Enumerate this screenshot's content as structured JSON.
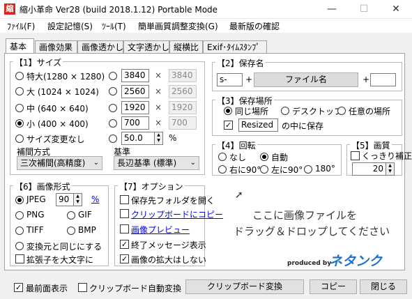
{
  "window": {
    "title": "縮小革命 Ver28  (build 2018.1.12)   Portable Mode",
    "icon_char": "縮",
    "minimize": "—",
    "maximize": "☐",
    "close": "✕"
  },
  "menu": [
    "ﾌｧｲﾙ(F)",
    "設定記憶(S)",
    "ﾂｰﾙ(T)",
    "簡単画質調整変換(G)",
    "最新版の確認"
  ],
  "tabs": [
    "基本",
    "画像効果",
    "画像透かし",
    "文字透かし",
    "縦横比",
    "Exif･ﾀｲﾑｽﾀﾝﾌﾟ"
  ],
  "size": {
    "title": "【1】サイズ",
    "presets": [
      {
        "label": "特大(1280 × 1280)",
        "selected": false
      },
      {
        "label": "大 (1024 × 1024)",
        "selected": false
      },
      {
        "label": "中  (640 × 640)",
        "selected": false
      },
      {
        "label": "小  (400 × 400)",
        "selected": true
      },
      {
        "label": "サイズ変更なし",
        "selected": false
      }
    ],
    "custom": [
      {
        "value": "3840",
        "value2": "3840"
      },
      {
        "value": "2560",
        "value2": "2560"
      },
      {
        "value": "1920",
        "value2": "1920"
      },
      {
        "value": "700",
        "value2": "700"
      }
    ],
    "cross": "×",
    "percent_value": "50.0",
    "percent_unit": "%",
    "interp_label": "補間方式",
    "interp_value": "三次補間(高精度)",
    "basis_label": "基準",
    "basis_value": "長辺基準 (標準)"
  },
  "savename": {
    "title": "【2】保存名",
    "prefix": "s-",
    "plus": "+",
    "filename_button": "ファイル名",
    "suffix": ""
  },
  "saveplace": {
    "title": "【3】保存場所",
    "options": [
      {
        "label": "同じ場所",
        "selected": true
      },
      {
        "label": "デスクトップ",
        "selected": false
      },
      {
        "label": "任意の場所",
        "selected": false
      }
    ],
    "resized_checked": true,
    "resized_value": "Resized",
    "resized_suffix": "の中に保存"
  },
  "rotate": {
    "title": "【4】回転",
    "options": [
      {
        "label": "なし",
        "selected": false
      },
      {
        "label": "自動",
        "selected": true
      },
      {
        "label": "右に90°",
        "selected": false
      },
      {
        "label": "左に90°",
        "selected": false
      },
      {
        "label": "180°",
        "selected": false
      }
    ]
  },
  "quality": {
    "title": "【5】画質",
    "sharpen_label": "くっきり補正",
    "sharpen_checked": false,
    "value": "20"
  },
  "format": {
    "title": "【6】画像形式",
    "jpeg_label": "JPEG",
    "jpeg_quality": "90",
    "jpeg_percent": "%",
    "options": [
      {
        "label": "JPEG",
        "selected": true
      },
      {
        "label": "PNG",
        "selected": false
      },
      {
        "label": "GIF",
        "selected": false
      },
      {
        "label": "TIFF",
        "selected": false
      },
      {
        "label": "BMP",
        "selected": false
      },
      {
        "label": "変換元と同じにする",
        "selected": false
      }
    ],
    "uppercase_label": "拡張子を大文字に",
    "uppercase_checked": false
  },
  "options": {
    "title": "【7】オプション",
    "items": [
      {
        "label": "保存先フォルダを開く",
        "checked": false,
        "link": false
      },
      {
        "label": "クリップボードにコピー",
        "checked": false,
        "link": true
      },
      {
        "label": "画像プレビュー",
        "checked": false,
        "link": true
      },
      {
        "label": "終了メッセージ表示",
        "checked": true,
        "link": false
      },
      {
        "label": "画像の拡大はしない",
        "checked": true,
        "link": false
      }
    ]
  },
  "drop": {
    "line1": "ここに画像ファイルを",
    "line2": "ドラッグ＆ドロップしてください"
  },
  "brand": {
    "produced_by": "produced by",
    "logo": "ネタンク",
    "logo_color": "#1e73c8"
  },
  "footer": {
    "topmost_label": "最前面表示",
    "topmost_checked": true,
    "clipauto_label": "クリップボード自動変換",
    "clipauto_checked": false,
    "clip_convert": "クリップボード変換",
    "copy": "コピー",
    "close": "閉じる"
  }
}
